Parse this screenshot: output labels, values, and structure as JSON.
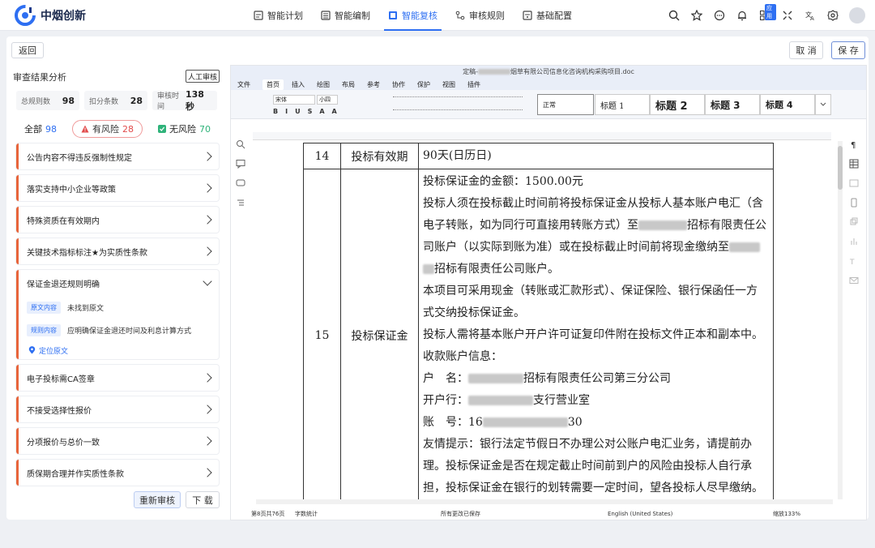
{
  "app": {
    "name": "中烟创新"
  },
  "nav": [
    {
      "label": "智能计划",
      "icon": "plan-icon"
    },
    {
      "label": "智能编制",
      "icon": "compile-icon"
    },
    {
      "label": "智能复核",
      "icon": "review-icon",
      "active": true
    },
    {
      "label": "审核规则",
      "icon": "rule-icon"
    },
    {
      "label": "基础配置",
      "icon": "config-icon"
    }
  ],
  "header_icons": {
    "app_badge": "应用"
  },
  "toolbar": {
    "back_label": "返回",
    "cancel_label": "取 消",
    "save_label": "保 存"
  },
  "left": {
    "title": "审查结果分析",
    "manual_label": "人工审核",
    "stats": [
      {
        "label": "总规则数",
        "value": "98"
      },
      {
        "label": "扣分条数",
        "value": "28"
      },
      {
        "label": "审核时间",
        "value": "138秒"
      }
    ],
    "filters": {
      "all_label": "全部",
      "all_count": "98",
      "risk_label": "有风险",
      "risk_count": "28",
      "norisk_label": "无风险",
      "norisk_count": "70"
    },
    "items_before": [
      "公告内容不得违反强制性规定",
      "落实支持中小企业等政策",
      "特殊资质在有效期内",
      "关键技术指标标注★为实质性条款"
    ],
    "expanded": {
      "title": "保证金退还规则明确",
      "original_tag": "原文内容",
      "original_text": "未找到原文",
      "rule_tag": "规则内容",
      "rule_text": "应明确保证金退还时间及利息计算方式",
      "locate_label": "定位原文"
    },
    "items_after": [
      "电子投标需CA签章",
      "不接受选择性报价",
      "分项报价与总价一致",
      "质保期合理并作实质性条款"
    ],
    "rereview_label": "重新审核",
    "download_label": "下 载"
  },
  "doc": {
    "title": "定稿-",
    "title_rest": "烟草有限公司信息化咨询机构采购项目.doc",
    "menu": [
      "文件",
      "首页",
      "插入",
      "绘图",
      "布局",
      "参考",
      "协作",
      "保护",
      "视图",
      "插件"
    ],
    "font_name": "宋体",
    "font_size": "小四",
    "styles": [
      "正常",
      "标题 1",
      "标题 2",
      "标题 3",
      "标题 4"
    ],
    "row14": {
      "no": "14",
      "name": "投标有效期",
      "content": "90天(日历日)"
    },
    "row15": {
      "no": "15",
      "name": "投标保证金",
      "l1": "投标保证金的金额：1500.00元",
      "l2": "投标人须在投标截止时间前将投标保证金从投标人基本账户电汇（含",
      "l3a": "电子转账，如为同行可直接用转账方式）至",
      "l3b": "招标有限责任公",
      "l4a": "司账户（以实际到账为准）或在投标截止时间前将现金缴纳至",
      "l5b": "招标有限责任公司账户。",
      "l6": "本项目可采用现金（转账或汇款形式）、保证保险、银行保函任一方",
      "l7": "式交纳投标保证金。",
      "l8": "投标人需将基本账户开户许可证复印件附在投标文件正本和副本中。",
      "l9": "收款账户信息：",
      "l10a": "户　名：",
      "l10b": "招标有限责任公司第三分公司",
      "l11a": "开户行：",
      "l11b": "支行营业室",
      "l12a": "账　号：16",
      "l12b": "30",
      "l13": "友情提示：银行法定节假日不办理公对公账户电汇业务，请提前办",
      "l14": "理。投标保证金是否在规定截止时间前到户的风险由投标人自行承",
      "l15": "担，投标保证金在银行的划转需要一定时间，望各投标人尽早缴纳。"
    },
    "status": {
      "page": "第8页共76页",
      "wordcount": "字数统计",
      "saved": "所有更改已保存",
      "lang": "English (United States)",
      "zoom": "缩放133%"
    }
  }
}
